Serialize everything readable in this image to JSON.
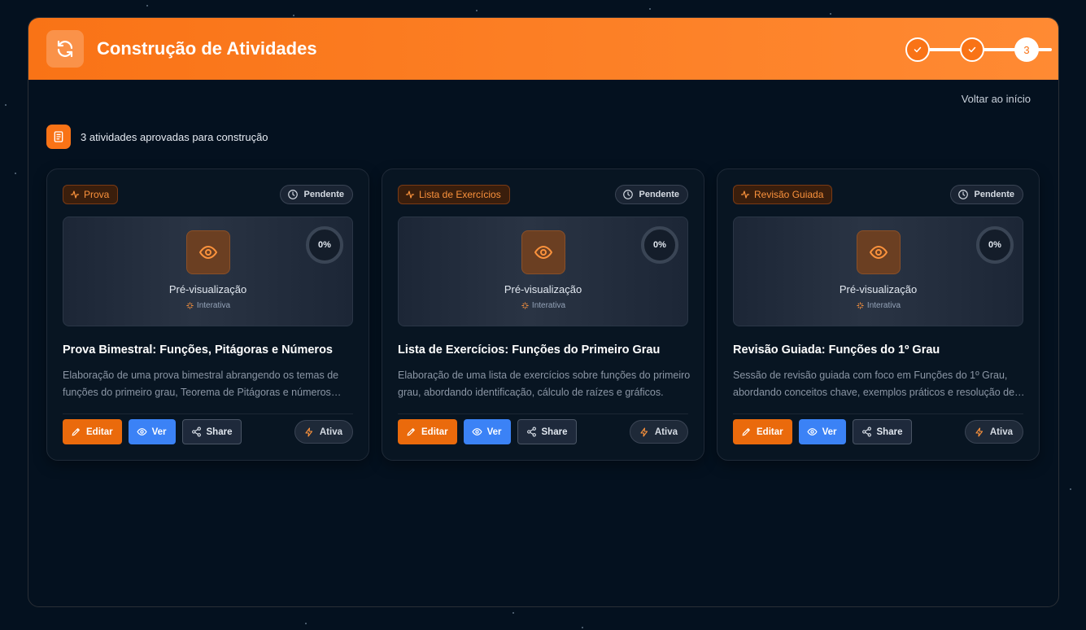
{
  "header": {
    "title": "Construção de Atividades"
  },
  "stepper": {
    "current_step": "3"
  },
  "nav": {
    "back_label": "Voltar ao início"
  },
  "summary": {
    "text": "3 atividades aprovadas para construção"
  },
  "cards": [
    {
      "type": "Prova",
      "status": "Pendente",
      "preview_label": "Pré-visualização",
      "preview_sub": "Interativa",
      "progress": "0%",
      "title": "Prova Bimestral: Funções, Pitágoras e Números",
      "description": "Elaboração de uma prova bimestral abrangendo os temas de funções do primeiro grau, Teorema de Pitágoras e números racionais.",
      "edit_label": "Editar",
      "view_label": "Ver",
      "share_label": "Share",
      "active_label": "Ativa"
    },
    {
      "type": "Lista de Exercícios",
      "status": "Pendente",
      "preview_label": "Pré-visualização",
      "preview_sub": "Interativa",
      "progress": "0%",
      "title": "Lista de Exercícios: Funções do Primeiro Grau",
      "description": "Elaboração de uma lista de exercícios sobre funções do primeiro grau, abordando identificação, cálculo de raízes e gráficos.",
      "edit_label": "Editar",
      "view_label": "Ver",
      "share_label": "Share",
      "active_label": "Ativa"
    },
    {
      "type": "Revisão Guiada",
      "status": "Pendente",
      "preview_label": "Pré-visualização",
      "preview_sub": "Interativa",
      "progress": "0%",
      "title": "Revisão Guiada: Funções do 1º Grau",
      "description": "Sessão de revisão guiada com foco em Funções do 1º Grau, abordando conceitos chave, exemplos práticos e resolução de exercícios.",
      "edit_label": "Editar",
      "view_label": "Ver",
      "share_label": "Share",
      "active_label": "Ativa"
    }
  ],
  "colors": {
    "accent": "#f97316",
    "primary_button": "#3b82f6",
    "background": "#04111f"
  },
  "icons": [
    "refresh-icon",
    "check-icon",
    "document-icon",
    "activity-icon",
    "clock-icon",
    "eye-icon",
    "sparkle-icon",
    "edit-icon",
    "share-icon",
    "bolt-icon"
  ]
}
